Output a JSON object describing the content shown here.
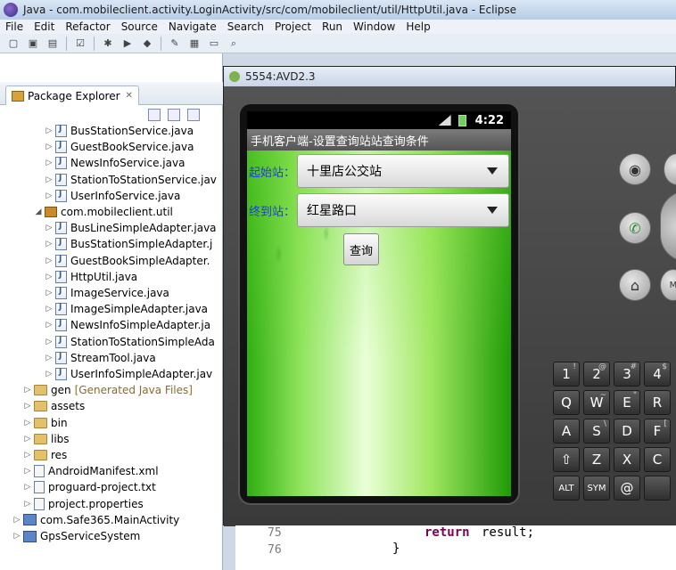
{
  "window": {
    "title": "Java - com.mobileclient.activity.LoginActivity/src/com/mobileclient/util/HttpUtil.java - Eclipse"
  },
  "menu": [
    "File",
    "Edit",
    "Refactor",
    "Source",
    "Navigate",
    "Search",
    "Project",
    "Run",
    "Window",
    "Help"
  ],
  "package_explorer": {
    "tab_label": "Package Explorer",
    "rows": [
      {
        "label": "BusStationService.java",
        "type": "java",
        "indent": 4
      },
      {
        "label": "GuestBookService.java",
        "type": "java",
        "indent": 4
      },
      {
        "label": "NewsInfoService.java",
        "type": "java",
        "indent": 4
      },
      {
        "label": "StationToStationService.jav",
        "type": "java",
        "indent": 4
      },
      {
        "label": "UserInfoService.java",
        "type": "java",
        "indent": 4
      },
      {
        "label": "com.mobileclient.util",
        "type": "pkg",
        "indent": 3,
        "expanded": true
      },
      {
        "label": "BusLineSimpleAdapter.java",
        "type": "java",
        "indent": 4
      },
      {
        "label": "BusStationSimpleAdapter.j",
        "type": "java",
        "indent": 4
      },
      {
        "label": "GuestBookSimpleAdapter.",
        "type": "java",
        "indent": 4
      },
      {
        "label": "HttpUtil.java",
        "type": "java",
        "indent": 4
      },
      {
        "label": "ImageService.java",
        "type": "java",
        "indent": 4
      },
      {
        "label": "ImageSimpleAdapter.java",
        "type": "java",
        "indent": 4
      },
      {
        "label": "NewsInfoSimpleAdapter.ja",
        "type": "java",
        "indent": 4
      },
      {
        "label": "StationToStationSimpleAda",
        "type": "java",
        "indent": 4
      },
      {
        "label": "StreamTool.java",
        "type": "java",
        "indent": 4
      },
      {
        "label": "UserInfoSimpleAdapter.jav",
        "type": "java",
        "indent": 4
      },
      {
        "label": "gen",
        "suffix": "[Generated Java Files]",
        "type": "fold",
        "indent": 2
      },
      {
        "label": "assets",
        "type": "fold",
        "indent": 2
      },
      {
        "label": "bin",
        "type": "fold",
        "indent": 2
      },
      {
        "label": "libs",
        "type": "fold",
        "indent": 2
      },
      {
        "label": "res",
        "type": "fold",
        "indent": 2
      },
      {
        "label": "AndroidManifest.xml",
        "type": "xml",
        "indent": 2
      },
      {
        "label": "proguard-project.txt",
        "type": "xml",
        "indent": 2
      },
      {
        "label": "project.properties",
        "type": "xml",
        "indent": 2
      },
      {
        "label": "com.Safe365.MainActivity",
        "type": "proj",
        "indent": 1
      },
      {
        "label": "GpsServiceSystem",
        "type": "proj",
        "indent": 1
      }
    ]
  },
  "emulator": {
    "title": "5554:AVD2.3",
    "status_time": "4:22",
    "app_title": "手机客户端-设置查询站站查询条件",
    "start_label": "起始站：",
    "start_value": "十里店公交站",
    "end_label": "终到站：",
    "end_value": "红星路口",
    "query_button": "查询"
  },
  "keyboard": {
    "keys": [
      {
        "k": "1",
        "s": "!"
      },
      {
        "k": "2",
        "s": "@"
      },
      {
        "k": "3",
        "s": "#"
      },
      {
        "k": "4",
        "s": "$"
      },
      {
        "k": "Q",
        "s": ""
      },
      {
        "k": "W",
        "s": "~"
      },
      {
        "k": "E",
        "s": "\""
      },
      {
        "k": "R",
        "s": ""
      },
      {
        "k": "A",
        "s": ""
      },
      {
        "k": "S",
        "s": "\\"
      },
      {
        "k": "D",
        "s": ""
      },
      {
        "k": "F",
        "s": "["
      },
      {
        "k": "⇧",
        "s": ""
      },
      {
        "k": "Z",
        "s": ""
      },
      {
        "k": "X",
        "s": ""
      },
      {
        "k": "C",
        "s": ""
      },
      {
        "k": "ALT",
        "s": ""
      },
      {
        "k": "SYM",
        "s": ""
      },
      {
        "k": "@",
        "s": ""
      },
      {
        "k": "",
        "s": ""
      }
    ]
  },
  "editor": {
    "line": "75",
    "keyword": "return",
    "code": " result;",
    "line2": "76",
    "brace": "}"
  }
}
